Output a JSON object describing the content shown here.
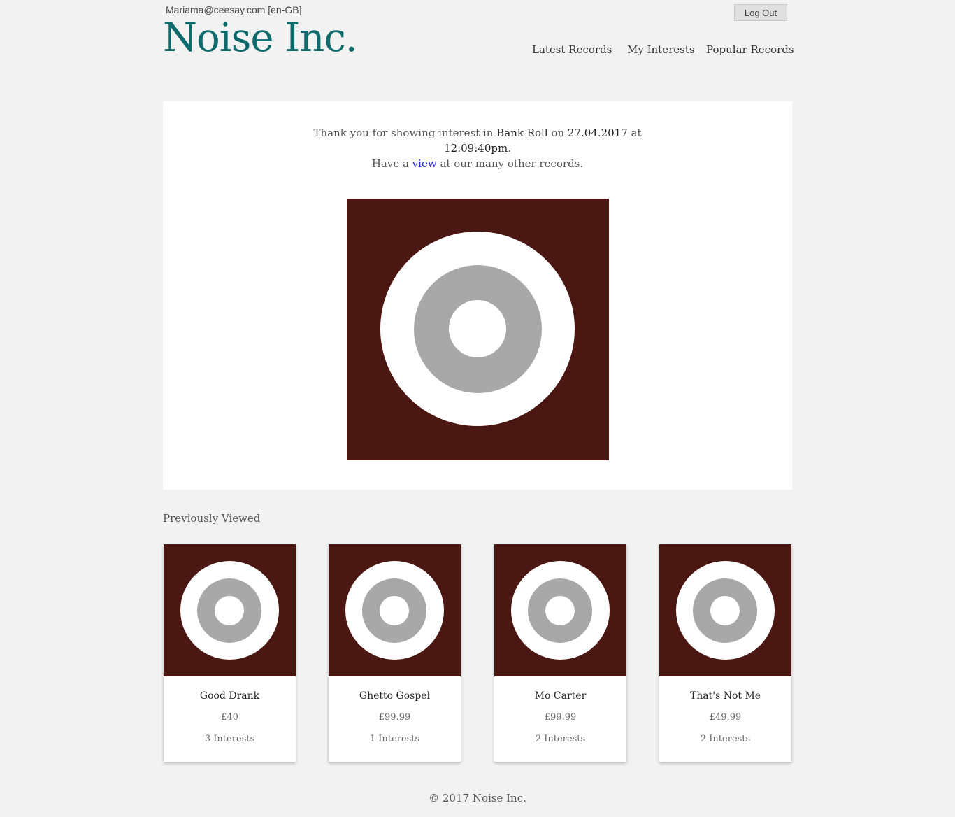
{
  "header": {
    "user_email": "Mariama@ceesay.com [en-GB]",
    "logout_label": "Log Out",
    "brand": "Noise Inc.",
    "nav": {
      "latest": "Latest Records",
      "interests": "My Interests",
      "popular": "Popular Records"
    }
  },
  "confirmation": {
    "prefix": "Thank you for showing interest in ",
    "record_name": "Bank Roll",
    "on": " on ",
    "date": "27.04.2017",
    "at": " at",
    "time": "12:09:40pm",
    "period": ".",
    "line3_prefix": "Have a ",
    "view_link": "view",
    "line3_suffix": " at our many other records."
  },
  "previously_viewed": {
    "title": "Previously Viewed",
    "items": [
      {
        "title": "Good Drank",
        "price": "£40",
        "interests": "3 Interests"
      },
      {
        "title": "Ghetto Gospel",
        "price": "£99.99",
        "interests": "1 Interests"
      },
      {
        "title": "Mo Carter",
        "price": "£99.99",
        "interests": "2 Interests"
      },
      {
        "title": "That's Not Me",
        "price": "£49.99",
        "interests": "2 Interests"
      }
    ]
  },
  "footer": {
    "copyright": "© 2017 Noise Inc."
  },
  "colors": {
    "brand": "#0f6b6b",
    "cover_background": "#4b1712",
    "disc_grey": "#a8a8a8",
    "link": "#1a1ad0"
  }
}
